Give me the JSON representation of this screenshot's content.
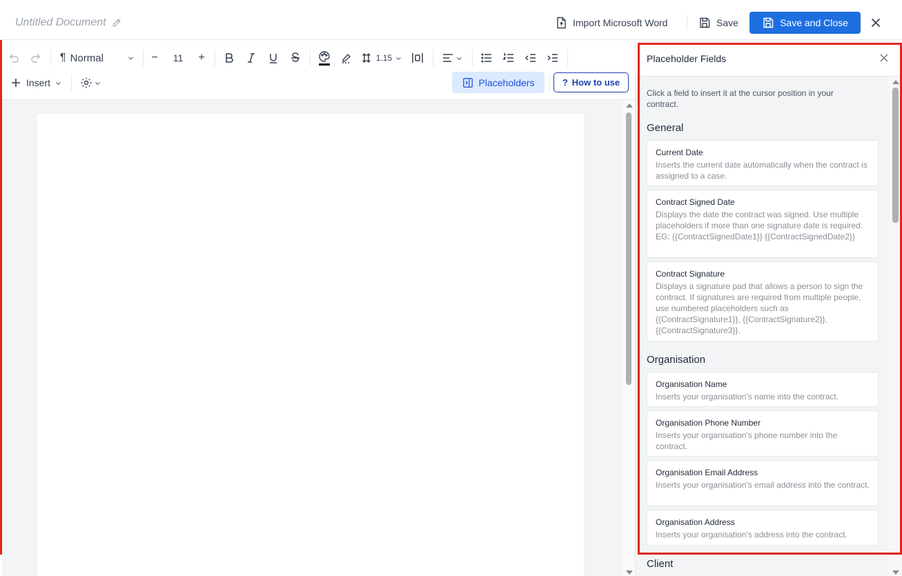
{
  "header": {
    "doc_title": "Untitled Document",
    "import_label": "Import Microsoft Word",
    "save_label": "Save",
    "save_close_label": "Save and Close"
  },
  "toolbar": {
    "style_label": "Normal",
    "font_size": "11",
    "line_spacing": "1.15",
    "insert_label": "Insert",
    "placeholders_label": "Placeholders",
    "howto_label": "How to use",
    "howto_icon": "?"
  },
  "panel": {
    "title": "Placeholder Fields",
    "intro": "Click a field to insert it at the cursor position in your contract.",
    "sections": [
      {
        "title": "General",
        "items": [
          {
            "title": "Current Date",
            "desc": "Inserts the current date automatically when the contract is assigned to a case."
          },
          {
            "title": "Contract Signed Date",
            "desc": "Displays the date the contract was signed. Use multiple placeholders if more than one signature date is required. EG: {{ContractSignedDate1}} {{ContractSignedDate2}}"
          },
          {
            "title": "Contract Signature",
            "desc": "Displays a signature pad that allows a person to sign the contract. If signatures are required from multiple people, use numbered placeholders such as {{ContractSignature1}}, {{ContractSignature2}}, {{ContractSignature3}}."
          }
        ]
      },
      {
        "title": "Organisation",
        "items": [
          {
            "title": "Organisation Name",
            "desc": "Inserts your organisation's name into the contract."
          },
          {
            "title": "Organisation Phone Number",
            "desc": "Inserts your organisation's phone number into the contract."
          },
          {
            "title": "Organisation Email Address",
            "desc": "Inserts your organisation's email address into the contract."
          },
          {
            "title": "Organisation Address",
            "desc": "Inserts your organisation's address into the contract."
          }
        ]
      },
      {
        "title": "Client",
        "items": []
      }
    ]
  },
  "colors": {
    "accent": "#1d6fe0",
    "highlight_red": "#e0261f",
    "placeholders_bg": "#dbeafe"
  }
}
